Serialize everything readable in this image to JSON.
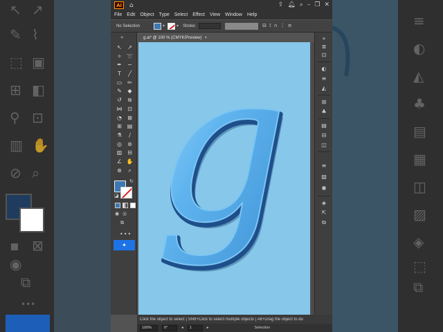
{
  "app": {
    "logo": "Ai",
    "menu": [
      "File",
      "Edit",
      "Object",
      "Type",
      "Select",
      "Effect",
      "View",
      "Window",
      "Help"
    ]
  },
  "control_bar": {
    "selection_label": "No Selection",
    "stroke_label": "Stroke:"
  },
  "document": {
    "tab_title": "g.ai* @ 100 % (CMYK/Preview)",
    "tab_close": "×"
  },
  "artwork": {
    "glyph": "g",
    "artboard_color": "#87c7ea",
    "glyph_color": "#62b6ee",
    "outline_color": "#1f4f8a"
  },
  "colors": {
    "fill": "#3d78b3",
    "stroke": "#ffffff",
    "accent": "#1e73e8"
  },
  "toolbar": {
    "more_label": "•••"
  },
  "status": {
    "help_text": "Click the object to select  |  Shift+Click to select multiple objects  |  Alt+Drag the object to du",
    "zoom": "100%",
    "rotation": "0°",
    "artboard_num": "1",
    "mode": "Selection"
  }
}
